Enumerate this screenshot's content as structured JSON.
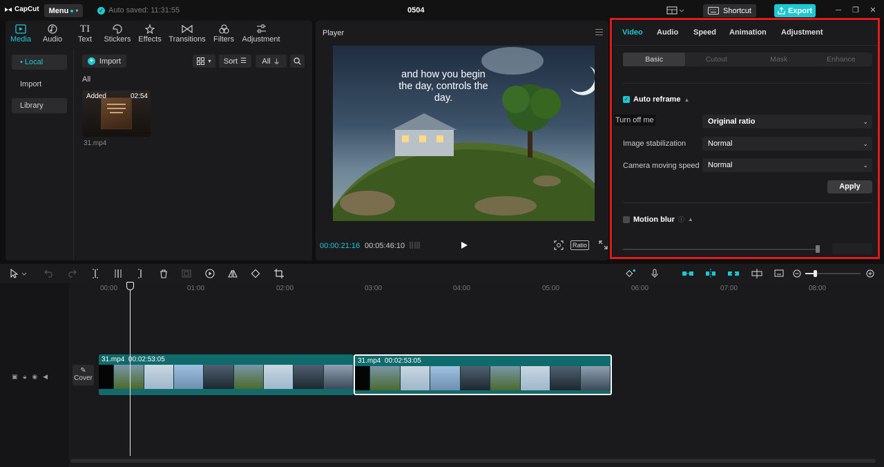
{
  "app": {
    "logo_text": "CapCut",
    "menu_label": "Menu",
    "autosave_text": "Auto saved: 11:31:55",
    "project_title": "0504",
    "shortcut_label": "Shortcut",
    "export_label": "Export",
    "accent_color": "#1ec8d3"
  },
  "media_tabs": [
    {
      "label": "Media",
      "icon": "media-icon"
    },
    {
      "label": "Audio",
      "icon": "audio-icon"
    },
    {
      "label": "Text",
      "icon": "text-icon"
    },
    {
      "label": "Stickers",
      "icon": "stickers-icon"
    },
    {
      "label": "Effects",
      "icon": "effects-icon"
    },
    {
      "label": "Transitions",
      "icon": "transitions-icon"
    },
    {
      "label": "Filters",
      "icon": "filters-icon"
    },
    {
      "label": "Adjustment",
      "icon": "adjustment-icon"
    }
  ],
  "sidebar": {
    "items": [
      {
        "label": "• Local"
      },
      {
        "label": "Import"
      },
      {
        "label": "Library"
      }
    ]
  },
  "media": {
    "import_label": "Import",
    "sort_label": "Sort",
    "filter_label": "All",
    "section_label": "All",
    "clip": {
      "badge": "Added",
      "duration": "02:54",
      "name": "31.mp4"
    }
  },
  "player": {
    "title": "Player",
    "caption": "and how you begin the day, controls the day.",
    "current_time": "00:00:21:16",
    "total_time": "00:05:46:10",
    "ratio_label": "Ratio"
  },
  "inspector": {
    "tabs": [
      "Video",
      "Audio",
      "Speed",
      "Animation",
      "Adjustment"
    ],
    "subtabs": [
      "Basic",
      "Cutout",
      "Mask",
      "Enhance"
    ],
    "auto_reframe_label": "Auto reframe",
    "tooltip": "Turn off me",
    "fields": [
      {
        "label": "Image stabilization",
        "value": "Normal"
      },
      {
        "label": "Camera moving speed",
        "value": "Normal"
      }
    ],
    "ratio_value": "Original ratio",
    "apply_label": "Apply",
    "motion_blur_label": "Motion blur"
  },
  "timeline": {
    "ruler": [
      "00:00",
      "01:00",
      "02:00",
      "03:00",
      "04:00",
      "05:00",
      "06:00",
      "07:00",
      "08:00"
    ],
    "cover_label": "Cover",
    "clips": [
      {
        "name": "31.mp4",
        "duration": "00:02:53:05"
      },
      {
        "name": "31.mp4",
        "duration": "00:02:53:05"
      }
    ]
  }
}
